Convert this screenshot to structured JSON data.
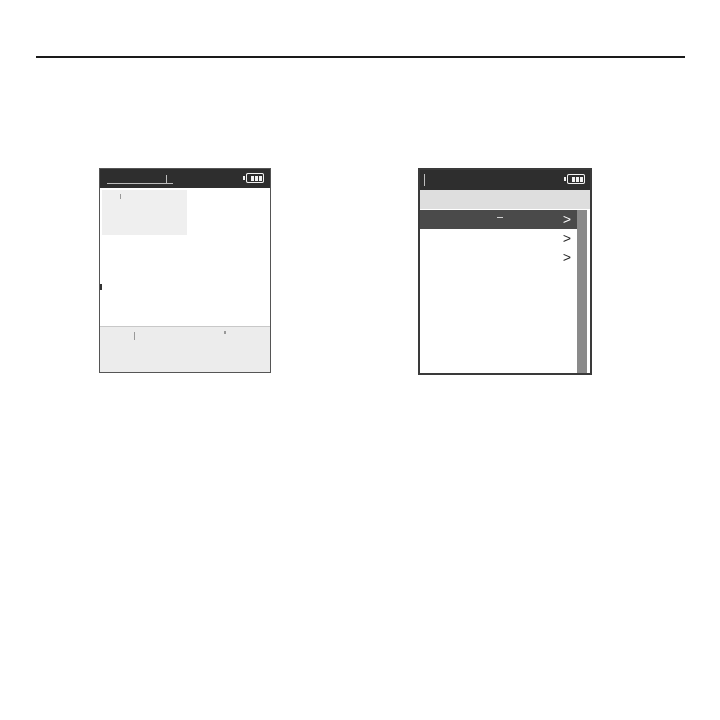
{
  "screen1": {
    "battery_icon": "battery-full-icon",
    "title": "",
    "panel_text": "",
    "footer_label": ""
  },
  "screen2": {
    "battery_icon": "battery-full-icon",
    "header": "",
    "menu_items": [
      {
        "label": "",
        "chevron": ">",
        "selected": true
      },
      {
        "label": "",
        "chevron": ">",
        "selected": false
      },
      {
        "label": "",
        "chevron": ">",
        "selected": false
      }
    ]
  },
  "colors": {
    "status_bar": "#2e2e2e",
    "selected_row": "#4a4a4a",
    "scrollbar": "#8a8a8a",
    "panel": "#efefef"
  }
}
